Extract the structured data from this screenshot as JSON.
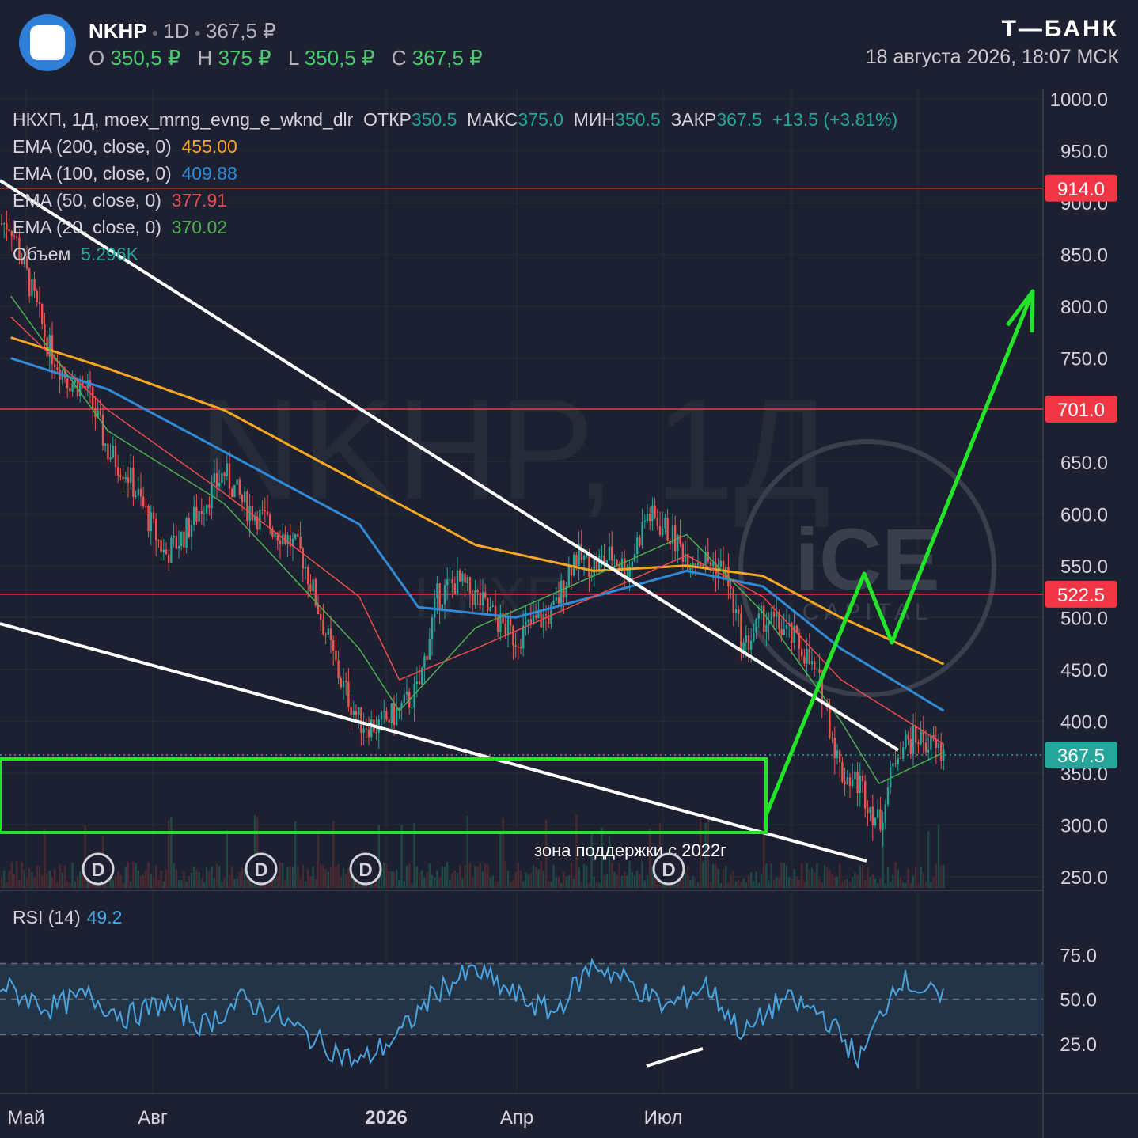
{
  "header": {
    "ticker": "NKHP",
    "interval": "1D",
    "price": "367,5 ₽",
    "ohlc": [
      {
        "k": "O",
        "v": "350,5 ₽"
      },
      {
        "k": "H",
        "v": "375 ₽"
      },
      {
        "k": "L",
        "v": "350,5 ₽"
      },
      {
        "k": "C",
        "v": "367,5 ₽"
      }
    ],
    "brand": "Т—БАНК",
    "timestamp": "18 августа 2026, 18:07 МСК"
  },
  "legend": {
    "main": {
      "label": "НКХП, 1Д, moex_mrng_evng_e_wknd_dlr",
      "open_k": "ОТКР",
      "open_v": "350.5",
      "high_k": "МАКС",
      "high_v": "375.0",
      "low_k": "МИН",
      "low_v": "350.5",
      "close_k": "ЗАКР",
      "close_v": "367.5",
      "change": "+13.5 (+3.81%)"
    },
    "ema200": {
      "label": "EMA (200, close, 0)",
      "value": "455.00",
      "color": "#f5a623"
    },
    "ema100": {
      "label": "EMA (100, close, 0)",
      "value": "409.88",
      "color": "#2f8bd8"
    },
    "ema50": {
      "label": "EMA (50, close, 0)",
      "value": "377.91",
      "color": "#e84c4c"
    },
    "ema20": {
      "label": "EMA (20, close, 0)",
      "value": "370.02",
      "color": "#4caf50"
    },
    "volume": {
      "label": "Объем",
      "value": "5.296K"
    }
  },
  "watermark": {
    "text": "NKHP, 1Д",
    "sub": "НКХП"
  },
  "ice_logo": {
    "big": "iCE",
    "small": "CAPITAL"
  },
  "annotation": {
    "support_zone": "зона поддержки с 2022г"
  },
  "rsi": {
    "label": "RSI (14)",
    "value": "49.2",
    "ticks": [
      "75.0",
      "50.0",
      "25.0"
    ]
  },
  "colors": {
    "background": "#1c2030",
    "up": "#26a69a",
    "down": "#ef5350",
    "level": "#f23645",
    "green_drawing": "#22e52a",
    "trendline": "#ffffff",
    "rsi_line": "#4aa3df"
  },
  "chart_data": {
    "type": "line",
    "price_axis": {
      "ylim": [
        237,
        1010
      ],
      "ticks": [
        "1000.0",
        "950.0",
        "900.0",
        "850.0",
        "800.0",
        "750.0",
        "650.0",
        "600.0",
        "550.0",
        "500.0",
        "450.0",
        "400.0",
        "350.0",
        "300.0",
        "250.0"
      ]
    },
    "x_axis_labels": [
      "Май",
      "Авг",
      "2026",
      "Апр",
      "Июл"
    ],
    "level_lines": [
      {
        "value": 914.0,
        "label": "914.0"
      },
      {
        "value": 701.0,
        "label": "701.0"
      },
      {
        "value": 522.5,
        "label": "522.5"
      }
    ],
    "last_price": {
      "value": 367.5,
      "label": "367.5"
    },
    "dividends": [
      "D",
      "D",
      "D",
      "D"
    ],
    "close_series": {
      "name": "НКХП",
      "x": [
        "2025-04-15",
        "2025-04-25",
        "2025-05-05",
        "2025-05-15",
        "2025-05-25",
        "2025-06-05",
        "2025-06-15",
        "2025-06-25",
        "2025-07-05",
        "2025-07-15",
        "2025-07-25",
        "2025-08-05",
        "2025-08-15",
        "2025-08-25",
        "2025-09-05",
        "2025-09-15",
        "2025-09-25",
        "2025-10-05",
        "2025-10-15",
        "2025-10-25",
        "2025-11-05",
        "2025-11-15",
        "2025-11-25",
        "2025-12-05",
        "2025-12-15",
        "2025-12-25",
        "2026-01-05",
        "2026-01-15",
        "2026-01-25",
        "2026-02-05",
        "2026-02-15",
        "2026-02-25",
        "2026-03-05",
        "2026-03-15",
        "2026-03-25",
        "2026-04-05",
        "2026-04-15",
        "2026-04-25",
        "2026-05-05",
        "2026-05-15",
        "2026-05-25",
        "2026-06-05",
        "2026-06-15",
        "2026-06-25",
        "2026-07-05",
        "2026-07-15",
        "2026-07-25",
        "2026-08-05",
        "2026-08-18"
      ],
      "values": [
        880,
        820,
        760,
        730,
        720,
        660,
        640,
        600,
        560,
        580,
        610,
        640,
        610,
        595,
        580,
        560,
        500,
        440,
        400,
        395,
        410,
        430,
        520,
        535,
        520,
        500,
        480,
        495,
        505,
        560,
        550,
        560,
        545,
        600,
        585,
        560,
        555,
        545,
        470,
        500,
        490,
        470,
        430,
        350,
        340,
        300,
        375,
        385,
        367.5
      ]
    },
    "ema": [
      {
        "name": "EMA (200, close, 0)",
        "x": [
          "2025-04-15",
          "2025-06-05",
          "2025-08-05",
          "2025-10-15",
          "2025-12-15",
          "2026-02-15",
          "2026-04-05",
          "2026-05-15",
          "2026-06-25",
          "2026-08-18"
        ],
        "values": [
          770,
          740,
          700,
          630,
          570,
          545,
          550,
          540,
          500,
          455
        ]
      },
      {
        "name": "EMA (100, close, 0)",
        "x": [
          "2025-04-15",
          "2025-06-05",
          "2025-08-05",
          "2025-10-15",
          "2025-11-15",
          "2026-01-05",
          "2026-02-15",
          "2026-04-05",
          "2026-05-15",
          "2026-06-25",
          "2026-08-18"
        ],
        "values": [
          750,
          720,
          660,
          590,
          510,
          500,
          520,
          545,
          530,
          470,
          410
        ]
      },
      {
        "name": "EMA (50, close, 0)",
        "x": [
          "2025-04-15",
          "2025-06-05",
          "2025-08-05",
          "2025-10-15",
          "2025-11-05",
          "2025-12-15",
          "2026-02-15",
          "2026-04-05",
          "2026-05-15",
          "2026-06-25",
          "2026-08-18"
        ],
        "values": [
          790,
          700,
          620,
          520,
          440,
          470,
          520,
          560,
          520,
          440,
          378
        ]
      },
      {
        "name": "EMA (20, close, 0)",
        "x": [
          "2025-04-15",
          "2025-06-05",
          "2025-08-05",
          "2025-10-15",
          "2025-11-05",
          "2025-12-15",
          "2026-02-15",
          "2026-04-05",
          "2026-05-15",
          "2026-06-25",
          "2026-07-15",
          "2026-08-18"
        ],
        "values": [
          810,
          680,
          610,
          470,
          410,
          490,
          540,
          580,
          505,
          400,
          340,
          370
        ]
      }
    ],
    "rsi_series": {
      "name": "RSI (14)",
      "ylim": [
        0,
        100
      ],
      "bands": [
        30,
        50,
        70
      ],
      "x": [
        "2025-04-15",
        "2025-05-05",
        "2025-05-25",
        "2025-06-15",
        "2025-07-05",
        "2025-07-25",
        "2025-08-15",
        "2025-09-05",
        "2025-09-25",
        "2025-10-15",
        "2025-11-05",
        "2025-11-25",
        "2025-12-15",
        "2026-01-05",
        "2026-01-25",
        "2026-02-15",
        "2026-03-05",
        "2026-03-25",
        "2026-04-15",
        "2026-05-05",
        "2026-05-25",
        "2026-06-15",
        "2026-07-05",
        "2026-07-25",
        "2026-08-18"
      ],
      "values": [
        55,
        45,
        52,
        40,
        48,
        35,
        50,
        38,
        25,
        14,
        30,
        55,
        66,
        52,
        42,
        70,
        60,
        45,
        58,
        30,
        50,
        42,
        16,
        62,
        49.2
      ]
    }
  }
}
